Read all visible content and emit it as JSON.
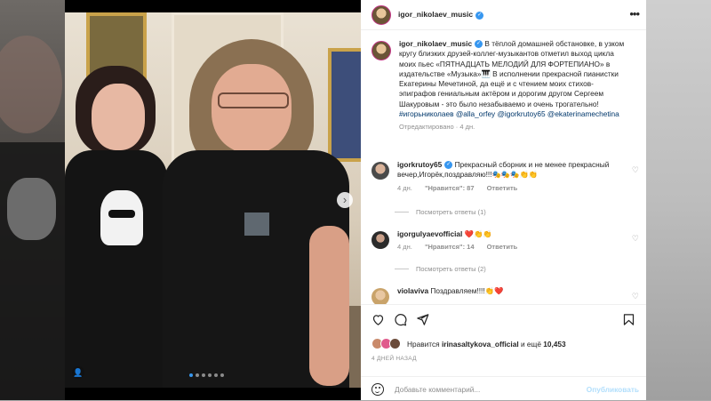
{
  "post": {
    "username": "igor_nikolaev_music",
    "caption": "В тёплой домашней обстановке, в узком кругу близких друзей-коллег-музыкантов отметил выход цикла моих пьес «ПЯТНАДЦАТЬ МЕЛОДИЙ ДЛЯ ФОРТЕПИАНО» в издательстве «Музыка»🎹 В исполнении прекрасной пианистки Екатерины Мечетиной, да ещё и с чтением моих стихов-эпиграфов гениальным актёром и дорогим другом Сергеем Шакуровым - это было незабываемо и очень трогательно!",
    "hashtag": "#игорьниколаев",
    "mentions": "@alla_orfey @igorkrutoy65 @ekaterinamechetina",
    "edited_meta": "Отредактировано · 4 дн."
  },
  "comments": [
    {
      "username": "igorkrutoy65",
      "text": "Прекрасный сборник и не менее прекрасный вечер,Игорёк,поздравляю!!!🎭🎭🎭👏👏",
      "age": "4 дн.",
      "likes": "\"Нравится\": 87",
      "reply": "Ответить",
      "view_replies": "Посмотреть ответы (1)"
    },
    {
      "username": "igorgulyaevofficial",
      "text": "❤️👏👏",
      "age": "4 дн.",
      "likes": "\"Нравится\": 14",
      "reply": "Ответить",
      "view_replies": "Посмотреть ответы (2)"
    },
    {
      "username": "violaviva",
      "text": "Поздравляем!!!!👏❤️"
    }
  ],
  "likes_line": {
    "prefix": "Нравится",
    "user": "irinasaltykova_official",
    "middle": "и ещё",
    "count": "10,453"
  },
  "time_ago": "4 ДНЕЙ НАЗАД",
  "composer": {
    "placeholder": "Добавьте комментарий...",
    "publish": "Опубликовать"
  },
  "carousel": {
    "slides": 6,
    "active_index": 0
  },
  "icons": [
    "more-icon",
    "verified-icon",
    "heart-icon",
    "comment-icon",
    "share-icon",
    "save-icon",
    "emoji-icon",
    "user-tag-icon",
    "next-arrow-icon"
  ],
  "colors": {
    "link": "#00376b",
    "verified": "#3797f0",
    "muted": "#8e8e8e",
    "publish_disabled": "#b2dffc"
  }
}
